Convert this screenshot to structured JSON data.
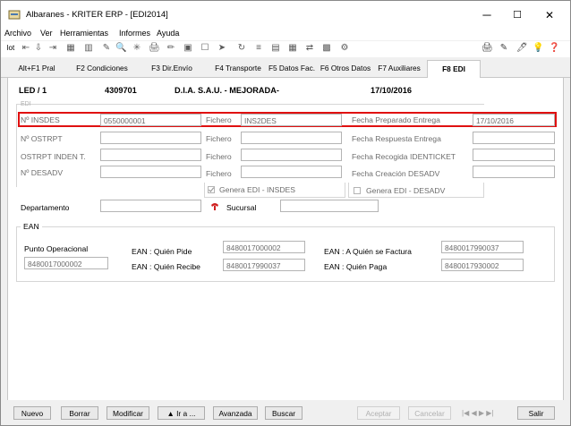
{
  "window": {
    "title": "Albaranes - KRITER ERP - [EDI2014]",
    "controls": {
      "minimize": "─",
      "maximize": "☐",
      "close": "✕"
    }
  },
  "menu": [
    "Archivo",
    "Ver",
    "Herramientas",
    "Informes",
    "Ayuda"
  ],
  "toolbar": {
    "left": [
      "lot",
      "⇤",
      "⇩",
      "⇥",
      "▦",
      "▥",
      "✎",
      "🔍",
      "✳",
      "🖨",
      "✏",
      "▣",
      "☐",
      "➤",
      "↻",
      "≡",
      "▤",
      "▦",
      "⇄",
      "▩",
      "⚙"
    ],
    "right": [
      "🖨",
      "✎",
      "🖊",
      "💡",
      "❓"
    ]
  },
  "tabs": [
    "Alt+F1 Pral",
    "F2 Condiciones",
    "F3 Dir.Envío",
    "F4 Transporte",
    "F5 Datos Fac.",
    "F6 Otros Datos",
    "F7 Auxiliares",
    "F8 EDI"
  ],
  "header": {
    "doc": "LED / 1",
    "number": "4309701",
    "client": "D.I.A. S.A.U. - MEJORADA-",
    "date": "17/10/2016"
  },
  "edi": {
    "legend": "EDI",
    "rows": [
      {
        "label": "Nº INSDES",
        "value": "0550000001",
        "fichero_label": "Fichero",
        "fichero": "INS2DES",
        "right_label": "Fecha Preparado Entrega",
        "right_value": "17/10/2016"
      },
      {
        "label": "Nº OSTRPT",
        "value": "",
        "fichero_label": "Fichero",
        "fichero": "",
        "right_label": "Fecha Respuesta Entrega",
        "right_value": ""
      },
      {
        "label": "OSTRPT INDEN T.",
        "value": "",
        "fichero_label": "Fichero",
        "fichero": "",
        "right_label": "Fecha Recogida IDENTICKET",
        "right_value": ""
      },
      {
        "label": "Nº DESADV",
        "value": "",
        "fichero_label": "Fichero",
        "fichero": "",
        "right_label": "Fecha Creación DESADV",
        "right_value": ""
      }
    ],
    "genera_insdes": "Genera EDI - INSDES",
    "genera_desadv": "Genera EDI - DESADV"
  },
  "departamento": {
    "label": "Departamento",
    "value": "",
    "sucursal_label": "Sucursal",
    "sucursal_value": ""
  },
  "ean": {
    "legend": "EAN",
    "punto_operacional_label": "Punto Operacional",
    "punto_operacional": "8480017000002",
    "quien_pide_label": "EAN : Quién Pide",
    "quien_pide": "8480017000002",
    "quien_recibe_label": "EAN : Quién Recibe",
    "quien_recibe": "8480017990037",
    "a_quien_factura_label": "EAN : A Quién se Factura",
    "a_quien_factura": "8480017990037",
    "quien_paga_label": "EAN : Quién Paga",
    "quien_paga": "8480017930002"
  },
  "buttons": {
    "nuevo": "Nuevo",
    "borrar": "Borrar",
    "modificar": "Modificar",
    "ira": "▲ Ir a ...",
    "avanzada": "Avanzada",
    "buscar": "Buscar",
    "aceptar": "Aceptar",
    "cancelar": "Cancelar",
    "nav": "|◀ ◀ ▶ ▶|",
    "salir": "Salir"
  },
  "colors": {
    "highlight": "#e01010",
    "flag_icon": "#d02020"
  }
}
